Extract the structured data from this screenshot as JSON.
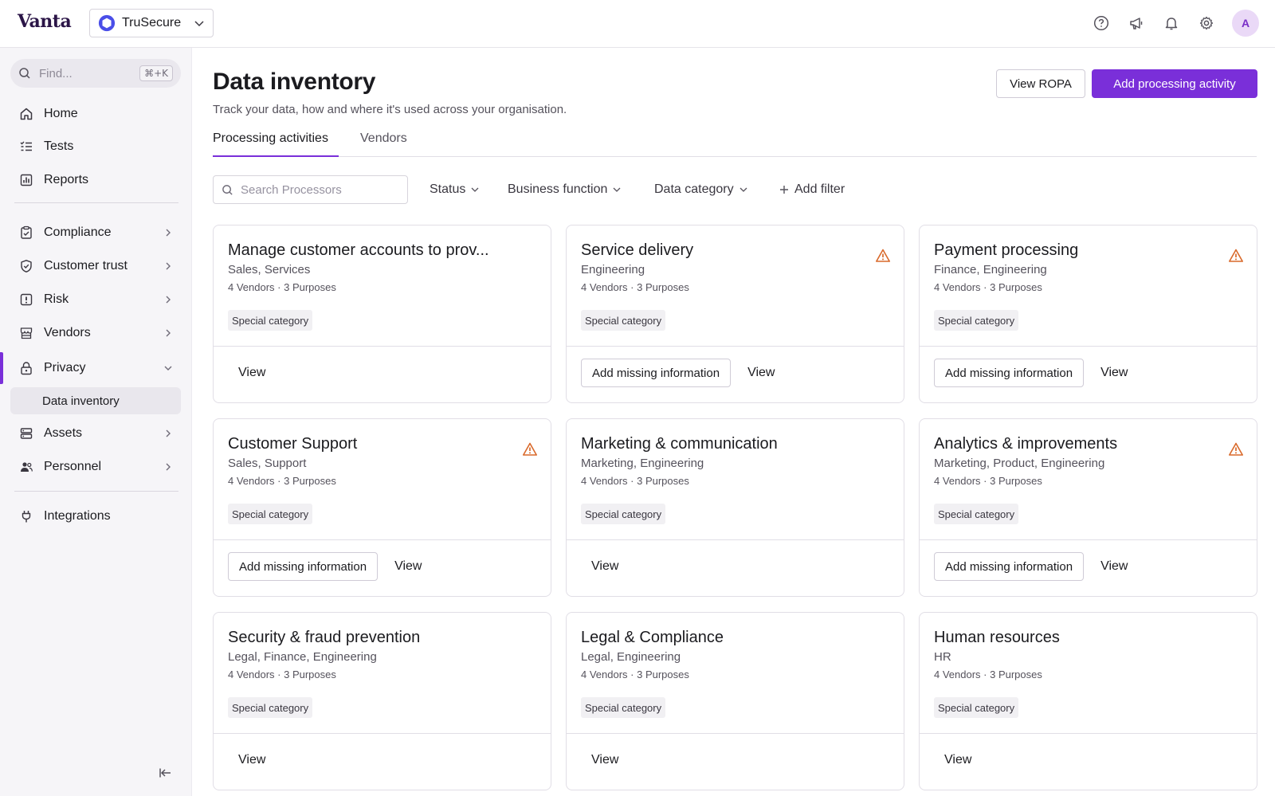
{
  "app": {
    "logo": "Vanta",
    "org": "TruSecure"
  },
  "sidebar": {
    "search_placeholder": "Find...",
    "search_shortcut": "⌘+K",
    "items": [
      {
        "label": "Home",
        "icon": "home-icon"
      },
      {
        "label": "Tests",
        "icon": "tests-icon"
      },
      {
        "label": "Reports",
        "icon": "reports-icon"
      },
      {
        "label": "Compliance",
        "icon": "compliance-icon"
      },
      {
        "label": "Customer trust",
        "icon": "shield-icon"
      },
      {
        "label": "Risk",
        "icon": "risk-icon"
      },
      {
        "label": "Vendors",
        "icon": "store-icon"
      },
      {
        "label": "Privacy",
        "icon": "lock-icon"
      },
      {
        "label": "Assets",
        "icon": "server-icon"
      },
      {
        "label": "Personnel",
        "icon": "people-icon"
      },
      {
        "label": "Integrations",
        "icon": "plug-icon"
      }
    ],
    "sub_items": [
      {
        "label": "Data inventory"
      }
    ]
  },
  "header": {
    "title": "Data inventory",
    "subtitle": "Track your data, how and where it's used across your organisation.",
    "view_ropa": "View ROPA",
    "add_activity": "Add processing activity"
  },
  "tabs": [
    {
      "label": "Processing activities"
    },
    {
      "label": "Vendors"
    }
  ],
  "filters": {
    "search_placeholder": "Search Processors",
    "status": "Status",
    "business_function": "Business function",
    "data_category": "Data category",
    "add_filter": "Add filter"
  },
  "card_labels": {
    "add_missing": "Add missing information",
    "view": "View"
  },
  "cards": [
    {
      "title": "Manage customer accounts to prov...",
      "functions": "Sales, Services",
      "meta": "4 Vendors · 3 Purposes",
      "tag": "Special category",
      "warning": false
    },
    {
      "title": "Service delivery",
      "functions": "Engineering",
      "meta": "4 Vendors · 3 Purposes",
      "tag": "Special category",
      "warning": true
    },
    {
      "title": "Payment processing",
      "functions": "Finance, Engineering",
      "meta": "4 Vendors · 3 Purposes",
      "tag": "Special category",
      "warning": true
    },
    {
      "title": "Customer Support",
      "functions": "Sales, Support",
      "meta": "4 Vendors · 3 Purposes",
      "tag": "Special category",
      "warning": true
    },
    {
      "title": "Marketing & communication",
      "functions": "Marketing, Engineering",
      "meta": "4 Vendors · 3 Purposes",
      "tag": "Special category",
      "warning": false
    },
    {
      "title": "Analytics & improvements",
      "functions": "Marketing, Product, Engineering",
      "meta": "4 Vendors · 3 Purposes",
      "tag": "Special category",
      "warning": true
    },
    {
      "title": "Security & fraud prevention",
      "functions": "Legal, Finance, Engineering",
      "meta": "4 Vendors · 3 Purposes",
      "tag": "Special category",
      "warning": false
    },
    {
      "title": "Legal & Compliance",
      "functions": "Legal, Engineering",
      "meta": "4 Vendors · 3 Purposes",
      "tag": "Special category",
      "warning": false
    },
    {
      "title": "Human resources",
      "functions": "HR",
      "meta": "4 Vendors · 3 Purposes",
      "tag": "Special category",
      "warning": false
    }
  ],
  "colors": {
    "accent": "#7a2fd9",
    "warning": "#d9692a"
  }
}
